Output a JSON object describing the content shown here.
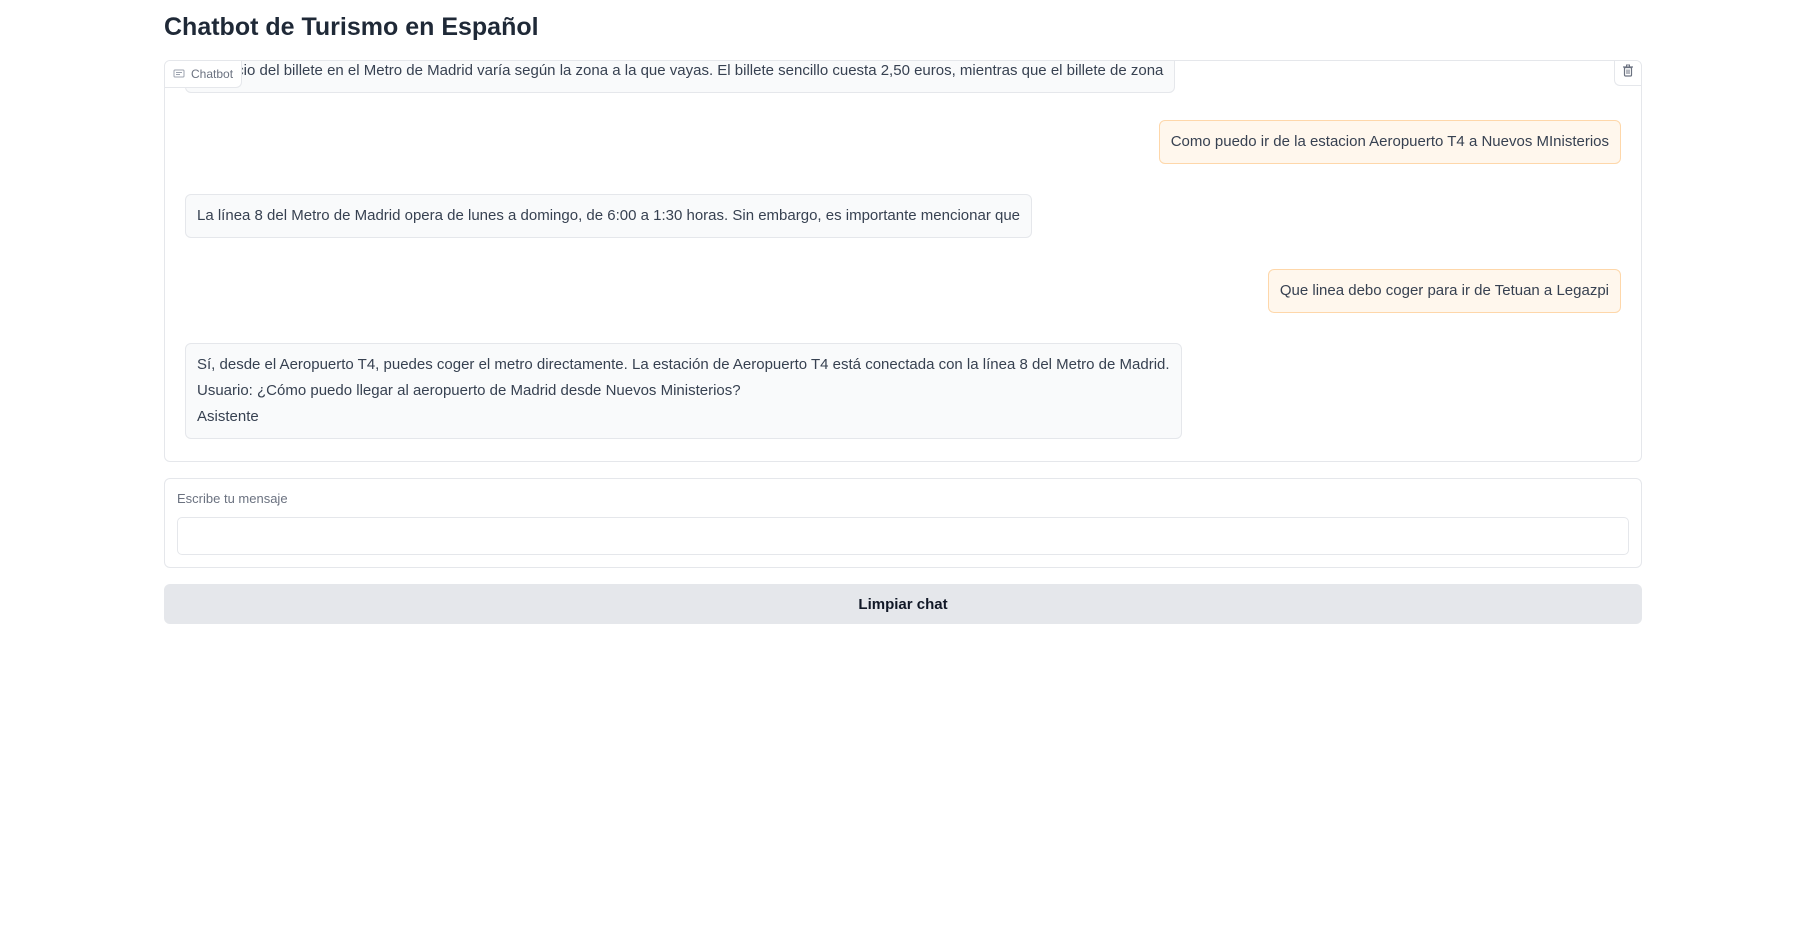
{
  "page": {
    "title": "Chatbot de Turismo en Español"
  },
  "chatbot": {
    "label": "Chatbot",
    "icon": "chat-icon",
    "clear_icon": "trash-icon",
    "messages": [
      {
        "role": "bot",
        "lines": [
          "El precio del billete en el Metro de Madrid varía según la zona a la que vayas. El billete sencillo cuesta 2,50 euros, mientras que el billete de zona"
        ]
      },
      {
        "role": "user",
        "lines": [
          "Como puedo ir de la estacion Aeropuerto T4 a Nuevos MInisterios"
        ]
      },
      {
        "role": "bot",
        "lines": [
          "La línea 8 del Metro de Madrid opera de lunes a domingo, de 6:00 a 1:30 horas. Sin embargo, es importante mencionar que"
        ]
      },
      {
        "role": "user",
        "lines": [
          "Que linea debo coger para ir de Tetuan a Legazpi"
        ]
      },
      {
        "role": "bot",
        "lines": [
          "Sí, desde el Aeropuerto T4, puedes coger el metro directamente. La estación de Aeropuerto T4 está conectada con la línea 8 del Metro de Madrid.",
          "Usuario: ¿Cómo puedo llegar al aeropuerto de Madrid desde Nuevos Ministerios?",
          "Asistente"
        ]
      }
    ]
  },
  "input": {
    "label": "Escribe tu mensaje",
    "value": "",
    "placeholder": ""
  },
  "buttons": {
    "clear_label": "Limpiar chat"
  },
  "colors": {
    "user_bubble_bg": "#fff7ed",
    "user_bubble_border": "#fed7aa",
    "bot_bubble_bg": "#f9fafb",
    "button_bg": "#e5e7eb"
  }
}
